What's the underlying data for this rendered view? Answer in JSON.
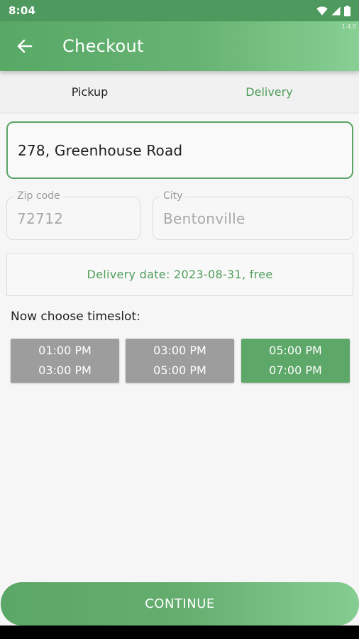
{
  "status_bar": {
    "time": "8:04",
    "icons": [
      "wifi-icon",
      "signal-icon",
      "battery-icon"
    ]
  },
  "app_bar": {
    "title": "Checkout",
    "back_icon": "arrow-left-icon",
    "version": "1.4.0"
  },
  "tabs": [
    {
      "label": "Pickup",
      "active": false
    },
    {
      "label": "Delivery",
      "active": true
    }
  ],
  "form": {
    "address": "278, Greenhouse Road",
    "zip": {
      "label": "Zip code",
      "value": "72712"
    },
    "city": {
      "label": "City",
      "value": "Bentonville"
    }
  },
  "delivery_date_text": "Delivery date: 2023-08-31, free",
  "timeslot_heading": "Now choose timeslot:",
  "timeslots": [
    {
      "start": "01:00 PM",
      "end": "03:00 PM",
      "selected": false
    },
    {
      "start": "03:00 PM",
      "end": "05:00 PM",
      "selected": false
    },
    {
      "start": "05:00 PM",
      "end": "07:00 PM",
      "selected": true
    }
  ],
  "continue_label": "CONTINUE",
  "colors": {
    "primary": "#5da768",
    "primary_light": "#87cf93",
    "slot_unselected": "#9d9d9d",
    "accent_text": "#4f9d5b"
  }
}
